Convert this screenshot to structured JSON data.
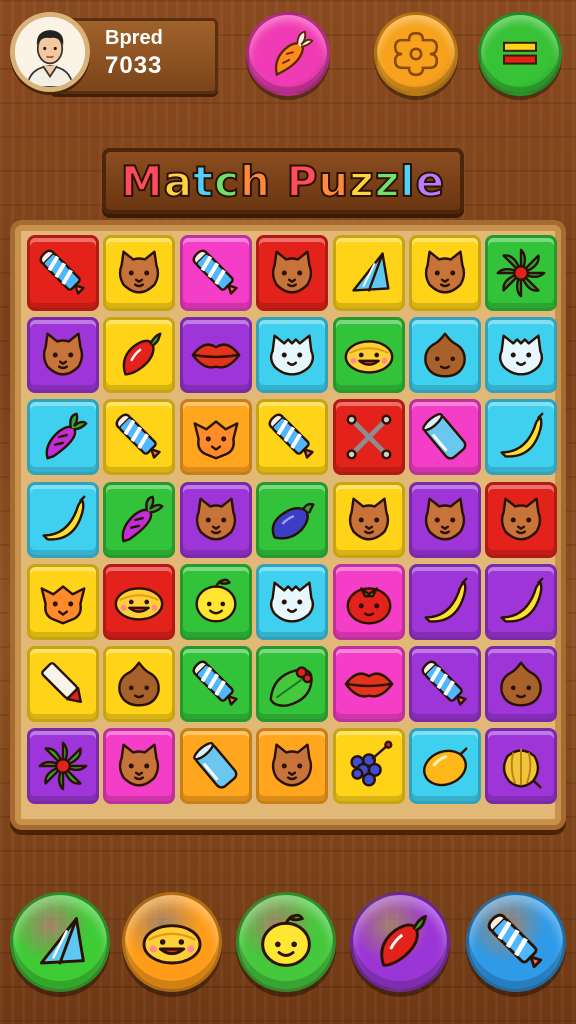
{
  "player": {
    "name": "Bpred",
    "score": "7033"
  },
  "title": {
    "letters": [
      {
        "ch": "M",
        "color": "#ff4b5c"
      },
      {
        "ch": "a",
        "color": "#ffd23f"
      },
      {
        "ch": "t",
        "color": "#4fd1ff"
      },
      {
        "ch": "c",
        "color": "#6fe06a"
      },
      {
        "ch": "h",
        "color": "#ff8a3d"
      },
      {
        "ch": " ",
        "color": "#ffffff"
      },
      {
        "ch": "P",
        "color": "#ff4b5c"
      },
      {
        "ch": "u",
        "color": "#ff8a3d"
      },
      {
        "ch": "z",
        "color": "#ffd23f"
      },
      {
        "ch": "z",
        "color": "#6fe06a"
      },
      {
        "ch": "l",
        "color": "#4fd1ff"
      },
      {
        "ch": "e",
        "color": "#b97cff"
      }
    ]
  },
  "top_buttons": [
    {
      "name": "carrot-bonus-button",
      "icon": "carrot-icon",
      "color": "#f03cb4"
    },
    {
      "name": "puzzle-piece-button",
      "icon": "puzzle-piece-icon",
      "color": "#f7a21c"
    },
    {
      "name": "menu-button",
      "icon": "menu-bars-icon",
      "color": "#38c236"
    }
  ],
  "board": {
    "rows": 7,
    "cols": 7,
    "colors": {
      "red": "#e4221c",
      "yellow": "#ffd317",
      "pink": "#f43ec7",
      "green": "#33c33a",
      "cyan": "#3fd0f0",
      "purple": "#9d35d8",
      "orange": "#ffa51e"
    },
    "tiles": [
      [
        "red:candy-stick-icon",
        "yellow:cat-face-icon",
        "pink:candy-stick-icon",
        "red:cat-face-icon",
        "yellow:paper-cone-icon",
        "yellow:cat-face-icon",
        "green:leafy-flower-icon"
      ],
      [
        "purple:cat-face-icon",
        "yellow:chili-pepper-icon",
        "purple:lips-icon",
        "cyan:fluffy-cat-icon",
        "green:smiley-bun-icon",
        "cyan:chestnut-face-icon",
        "cyan:fluffy-cat-icon"
      ],
      [
        "cyan:carrot-icon",
        "yellow:candy-stick-icon",
        "orange:fox-face-icon",
        "yellow:candy-stick-icon",
        "red:crossed-sticks-icon",
        "pink:battery-can-icon",
        "cyan:banana-icon"
      ],
      [
        "cyan:banana-icon",
        "green:carrot-icon",
        "purple:cat-face-icon",
        "green:eggplant-icon",
        "yellow:cat-face-icon",
        "purple:cat-face-icon",
        "red:cat-face-icon"
      ],
      [
        "yellow:fox-face-icon",
        "red:smiley-bun-icon",
        "green:lemon-face-icon",
        "cyan:fluffy-cat-icon",
        "pink:tomato-icon",
        "purple:banana-icon",
        "purple:banana-icon"
      ],
      [
        "yellow:crayon-icon",
        "yellow:chestnut-face-icon",
        "green:candy-stick-icon",
        "green:berry-leaf-icon",
        "pink:lips-icon",
        "purple:candy-stick-icon",
        "purple:chestnut-face-icon"
      ],
      [
        "purple:leafy-flower-icon",
        "pink:cat-face-icon",
        "orange:battery-can-icon",
        "orange:cat-face-icon",
        "yellow:grape-bunch-icon",
        "cyan:lemon-icon",
        "purple:gourd-icon"
      ]
    ]
  },
  "bottom_buttons": [
    {
      "name": "cone-booster-button",
      "icon": "paper-cone-icon",
      "color": "#3ecb35"
    },
    {
      "name": "bun-booster-button",
      "icon": "smiley-bun-icon",
      "color": "#ff9d1a"
    },
    {
      "name": "lemon-booster-button",
      "icon": "lemon-face-icon",
      "color": "#46c83c"
    },
    {
      "name": "pepper-booster-button",
      "icon": "chili-pepper-icon",
      "color": "#9b36d6"
    },
    {
      "name": "candy-booster-button",
      "icon": "candy-stick-icon",
      "color": "#2f9ae8"
    }
  ]
}
